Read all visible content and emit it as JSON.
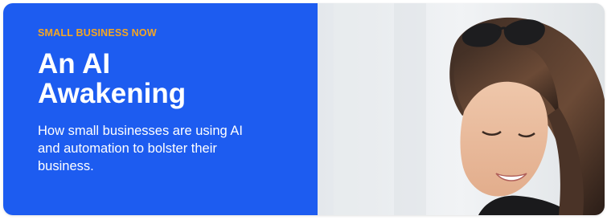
{
  "promo": {
    "eyebrow": "SMALL BUSINESS NOW",
    "title_line1": "An AI",
    "title_line2": "Awakening",
    "description": "How small businesses are using AI and automation to bolster their business.",
    "background_color": "#1d5cf0",
    "eyebrow_color": "#f5a623"
  },
  "photo": {
    "subject": "smiling woman with sunglasses on her head looking down",
    "icon": "photo-image"
  }
}
